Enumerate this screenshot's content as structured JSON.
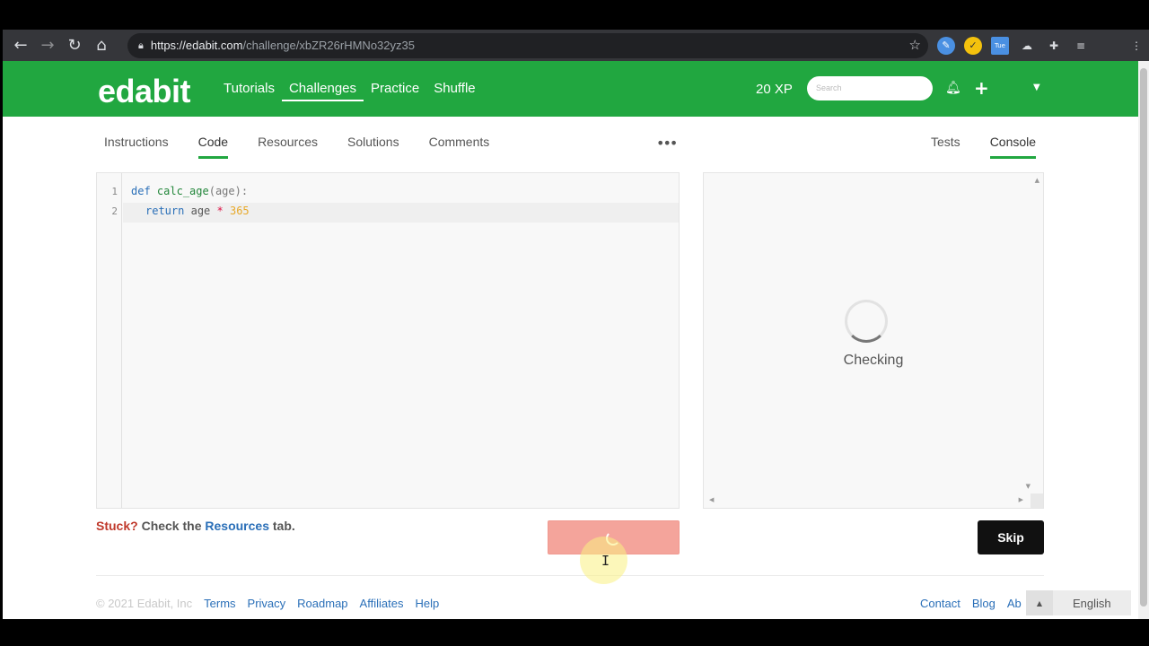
{
  "browser": {
    "url_host": "https://edabit.com",
    "url_path": "/challenge/xbZR26rHMNo32yz35",
    "calendar_ext_label": "Tue"
  },
  "header": {
    "logo": "edabit",
    "nav": [
      "Tutorials",
      "Challenges",
      "Practice",
      "Shuffle"
    ],
    "active_nav": "Challenges",
    "xp": "20 XP",
    "search_placeholder": "Search"
  },
  "tabs": {
    "left": [
      "Instructions",
      "Code",
      "Resources",
      "Solutions",
      "Comments"
    ],
    "active_left": "Code",
    "more": "•••",
    "right": [
      "Tests",
      "Console"
    ],
    "active_right": "Console"
  },
  "editor": {
    "line_numbers": [
      "1",
      "2"
    ],
    "line1": {
      "kw": "def",
      "fn": "calc_age",
      "params": "(age):"
    },
    "line2": {
      "kw": "return",
      "var": "age",
      "op": "*",
      "num": "365"
    }
  },
  "console": {
    "status": "Checking"
  },
  "help": {
    "stuck": "Stuck?",
    "check": " Check the ",
    "resources": "Resources",
    "tab": " tab."
  },
  "buttons": {
    "skip": "Skip"
  },
  "footer": {
    "copyright": "© 2021 Edabit, Inc",
    "left_links": [
      "Terms",
      "Privacy",
      "Roadmap",
      "Affiliates",
      "Help"
    ],
    "right_links": [
      "Contact",
      "Blog",
      "Ab"
    ],
    "language": "English"
  }
}
